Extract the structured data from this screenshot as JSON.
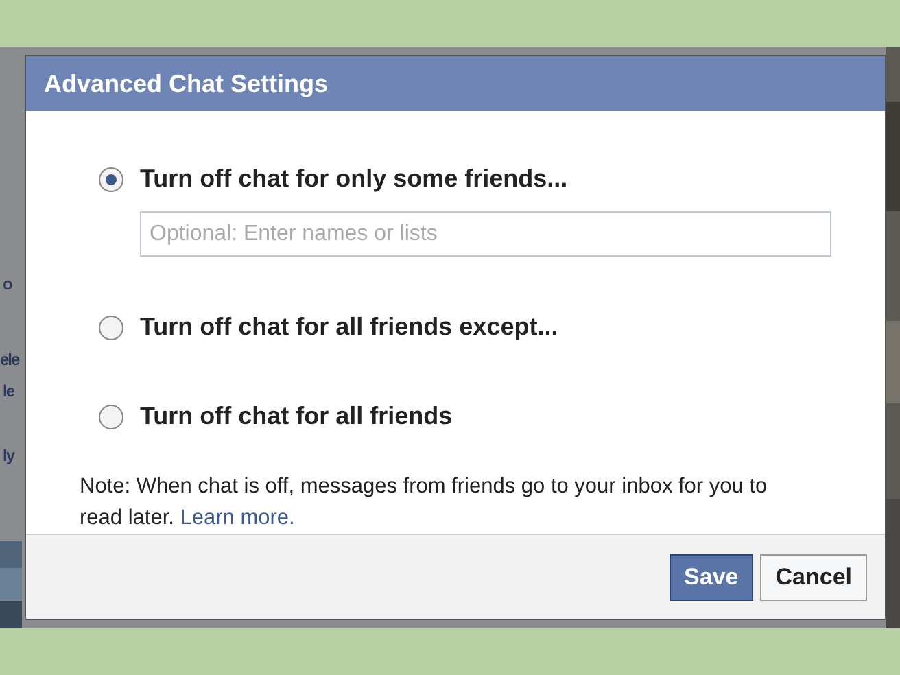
{
  "background": {
    "fragments": [
      {
        "text": "o"
      },
      {
        "text": "ele"
      },
      {
        "text": "le"
      },
      {
        "text": "ly"
      }
    ]
  },
  "dialog": {
    "title": "Advanced Chat Settings",
    "options": [
      {
        "label": "Turn off chat for only some friends...",
        "selected": true,
        "field": {
          "placeholder": "Optional: Enter names or lists"
        }
      },
      {
        "label": "Turn off chat for all friends except...",
        "selected": false
      },
      {
        "label": "Turn off chat for all friends",
        "selected": false
      }
    ],
    "note": "Note: When chat is off, messages from friends go to your inbox for you to read later.",
    "note_link": "Learn more.",
    "buttons": [
      {
        "label": "Save",
        "kind": "primary"
      },
      {
        "label": "Cancel",
        "kind": "secondary"
      }
    ]
  }
}
